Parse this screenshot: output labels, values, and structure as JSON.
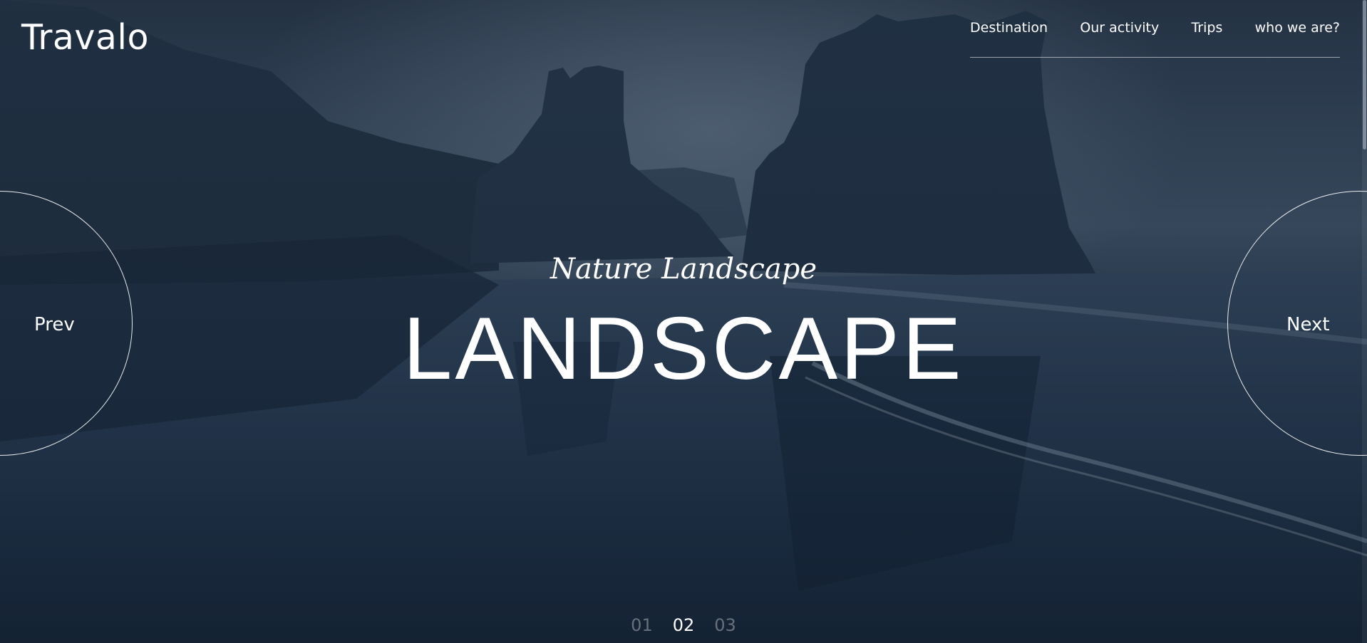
{
  "brand": {
    "logo": "Travalo"
  },
  "nav": {
    "items": [
      {
        "label": "Destination"
      },
      {
        "label": "Our activity"
      },
      {
        "label": "Trips"
      },
      {
        "label": "who we are?"
      }
    ]
  },
  "hero": {
    "subtitle": "Nature Landscape",
    "title": "LANDSCAPE",
    "background_description_colors": {
      "sky": "#5b6f86",
      "rocks": "#26384c",
      "sand": "#1c2d40",
      "water": "#3a5068"
    }
  },
  "controls": {
    "prev_label": "Prev",
    "next_label": "Next"
  },
  "pagination": {
    "pages": [
      "01",
      "02",
      "03"
    ],
    "current": "02"
  }
}
